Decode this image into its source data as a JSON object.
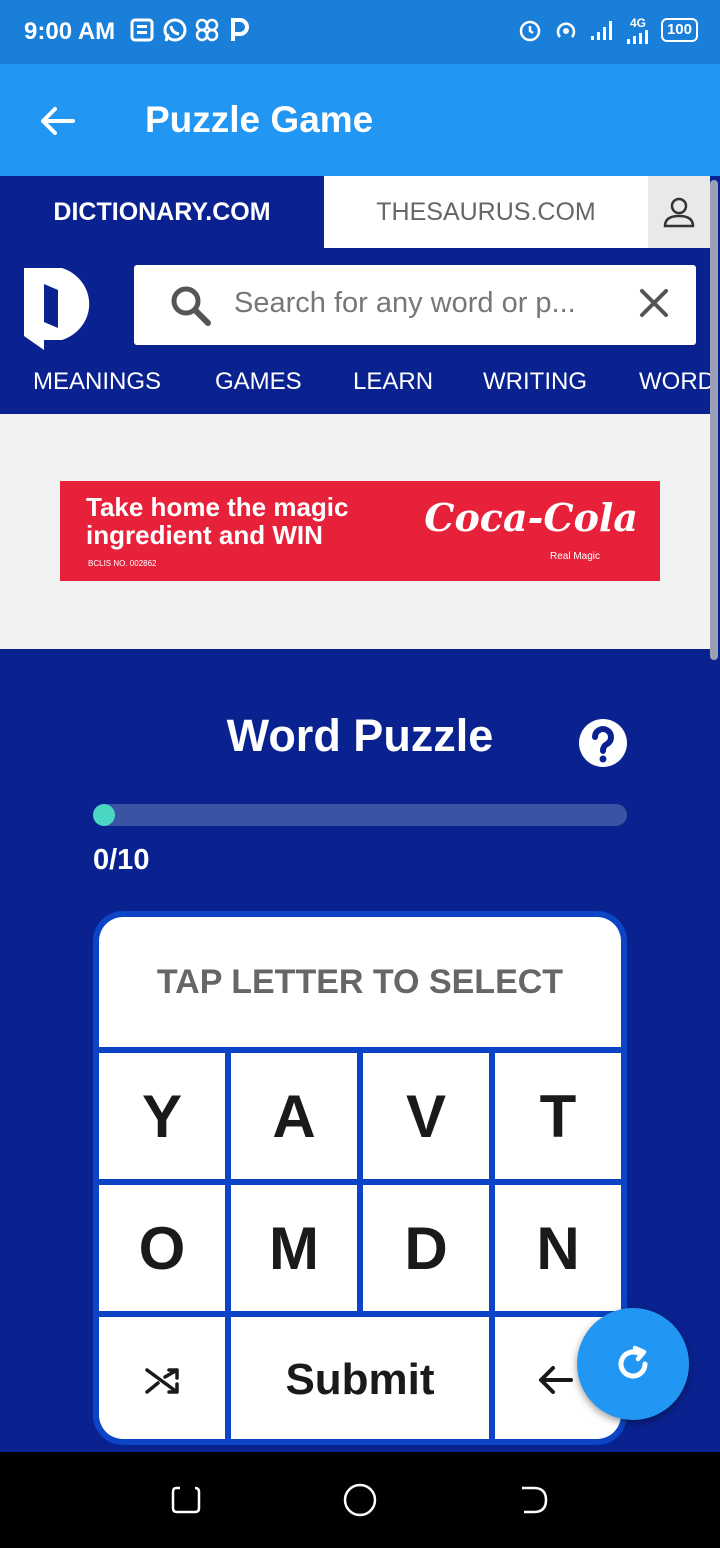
{
  "status_bar": {
    "time": "9:00 AM",
    "network": "4G",
    "battery": "100",
    "left_icons": [
      "news-icon",
      "whatsapp-icon",
      "pinwheel-icon",
      "p-icon"
    ],
    "right_icons": [
      "alarm-icon",
      "hotspot-icon",
      "signal-icon",
      "signal-4g-icon",
      "battery-icon"
    ]
  },
  "app_bar": {
    "title": "Puzzle Game"
  },
  "site_tabs": {
    "dictionary": "DICTIONARY.COM",
    "thesaurus": "THESAURUS.COM"
  },
  "search": {
    "placeholder": "Search for any word or p..."
  },
  "nav": [
    "MEANINGS",
    "GAMES",
    "LEARN",
    "WRITING",
    "WORD"
  ],
  "ad": {
    "headline_1": "Take home the magic",
    "headline_2": "ingredient and WIN",
    "license": "BCLIS NO. 002862",
    "brand": "Coca-Cola",
    "tagline": "Real Magic"
  },
  "puzzle": {
    "title": "Word Puzzle",
    "progress_label": "0/10",
    "progress_fraction": 0.0,
    "instruction": "TAP LETTER TO SELECT",
    "letters": [
      "Y",
      "A",
      "V",
      "T",
      "O",
      "M",
      "D",
      "N"
    ],
    "submit_label": "Submit"
  },
  "colors": {
    "status_bar": "#1a7fd9",
    "app_bar": "#2196f3",
    "page_bg": "#0a2290",
    "board_border": "#0b44c4",
    "progress_fill": "#4ad6c1",
    "ad_red": "#e8213a"
  }
}
